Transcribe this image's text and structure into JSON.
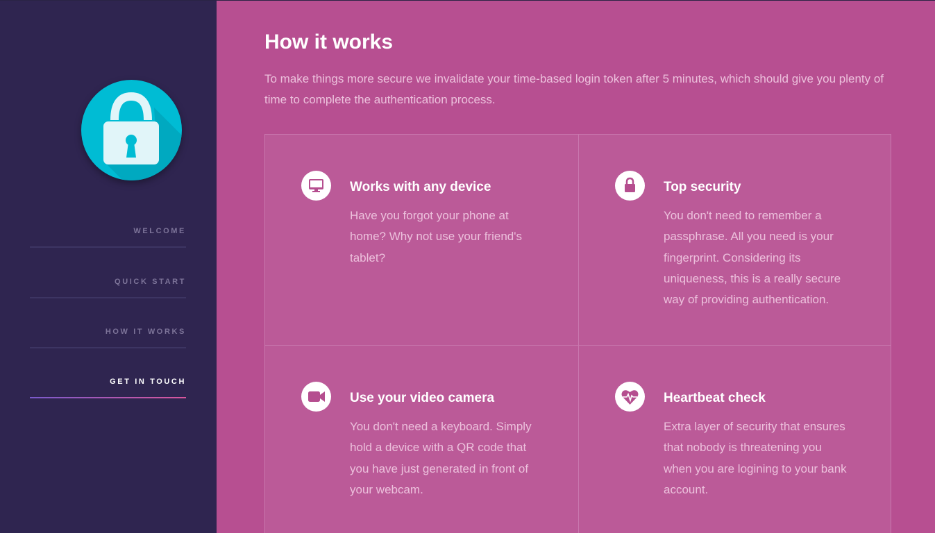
{
  "sidebar": {
    "logo_icon": "lock-icon",
    "nav": [
      {
        "label": "WELCOME",
        "active": false
      },
      {
        "label": "QUICK START",
        "active": false
      },
      {
        "label": "HOW IT WORKS",
        "active": false
      },
      {
        "label": "GET IN TOUCH",
        "active": true
      }
    ]
  },
  "main": {
    "title": "How it works",
    "intro": "To make things more secure we invalidate your time-based login token after 5 minutes, which should give you plenty of time to complete the authentication process.",
    "features": [
      {
        "icon": "monitor-icon",
        "title": "Works with any device",
        "text": "Have you forgot your phone at home? Why not use your friend's tablet?"
      },
      {
        "icon": "lock-icon",
        "title": "Top security",
        "text": "You don't need to remember a passphrase. All you need is your fingerprint. Considering its uniqueness, this is a really secure way of providing authentication."
      },
      {
        "icon": "video-camera-icon",
        "title": "Use your video camera",
        "text": "You don't need a keyboard. Simply hold a device with a QR code that you have just generated in front of your webcam."
      },
      {
        "icon": "heartbeat-icon",
        "title": "Heartbeat check",
        "text": "Extra layer of security that ensures that nobody is threatening you when you are logining to your bank account."
      }
    ]
  },
  "colors": {
    "sidebar_bg": "#2f2550",
    "main_bg": "#b74f91",
    "logo_bg": "#00bcd4",
    "accent": "#b54e8f"
  }
}
